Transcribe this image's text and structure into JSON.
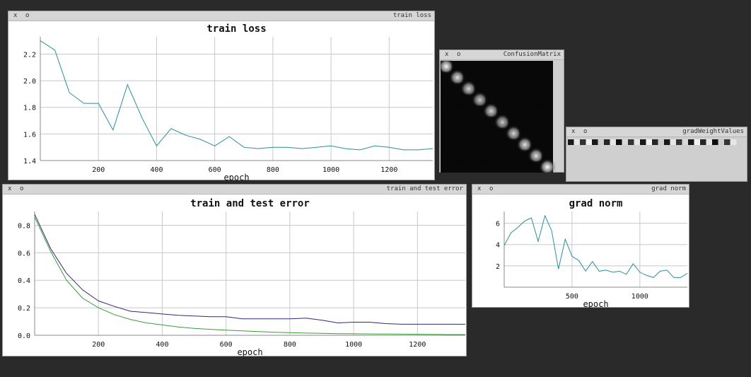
{
  "windows": {
    "train_loss": {
      "btn_x": "x",
      "btn_o": "o",
      "title": "train loss"
    },
    "confusion": {
      "btn_x": "x",
      "btn_o": "o",
      "title": "ConfusionMatrix"
    },
    "gradweight": {
      "btn_x": "x",
      "btn_o": "o",
      "title": "gradWeightValues"
    },
    "error": {
      "btn_x": "x",
      "btn_o": "o",
      "title": "train and test error"
    },
    "gradnorm": {
      "btn_x": "x",
      "btn_o": "o",
      "title": "grad norm"
    }
  },
  "colors": {
    "teal": "#2b8f9a",
    "navy": "#2d2a7a",
    "green": "#3a9a3a"
  },
  "chart_data": [
    {
      "id": "train_loss",
      "type": "line",
      "title": "train loss",
      "xlabel": "epoch",
      "ylabel": "",
      "xlim": [
        0,
        1350
      ],
      "ylim": [
        1.4,
        2.33
      ],
      "xticks": [
        "200",
        "400",
        "600",
        "800",
        "1000",
        "1200"
      ],
      "xtick_values": [
        200,
        400,
        600,
        800,
        1000,
        1200
      ],
      "yticks": [
        "1.4",
        "1.6",
        "1.8",
        "2.0",
        "2.2"
      ],
      "ytick_values": [
        1.4,
        1.6,
        1.8,
        2.0,
        2.2
      ],
      "series": [
        {
          "color": "#2b8f9a",
          "x": [
            0,
            50,
            100,
            150,
            200,
            250,
            300,
            350,
            400,
            450,
            500,
            550,
            600,
            650,
            700,
            750,
            800,
            850,
            900,
            950,
            1000,
            1050,
            1100,
            1150,
            1200,
            1250,
            1300,
            1350
          ],
          "y": [
            2.3,
            2.23,
            1.91,
            1.83,
            1.83,
            1.63,
            1.97,
            1.72,
            1.51,
            1.64,
            1.59,
            1.56,
            1.51,
            1.58,
            1.5,
            1.49,
            1.5,
            1.5,
            1.49,
            1.5,
            1.51,
            1.49,
            1.48,
            1.51,
            1.5,
            1.48,
            1.48,
            1.49
          ]
        }
      ]
    },
    {
      "id": "error",
      "type": "line",
      "title": "train and test error",
      "xlabel": "epoch",
      "ylabel": "",
      "xlim": [
        0,
        1350
      ],
      "ylim": [
        0,
        0.9
      ],
      "xticks": [
        "200",
        "400",
        "600",
        "800",
        "1000",
        "1200"
      ],
      "xtick_values": [
        200,
        400,
        600,
        800,
        1000,
        1200
      ],
      "yticks": [
        "0.0",
        "0.2",
        "0.4",
        "0.6",
        "0.8"
      ],
      "ytick_values": [
        0.0,
        0.2,
        0.4,
        0.6,
        0.8
      ],
      "series": [
        {
          "color": "#2d2a7a",
          "x": [
            0,
            50,
            100,
            150,
            200,
            250,
            300,
            350,
            400,
            450,
            500,
            550,
            600,
            650,
            700,
            750,
            800,
            850,
            900,
            950,
            1000,
            1050,
            1100,
            1150,
            1200,
            1250,
            1300,
            1350
          ],
          "y": [
            0.88,
            0.63,
            0.45,
            0.33,
            0.25,
            0.21,
            0.175,
            0.165,
            0.155,
            0.145,
            0.14,
            0.135,
            0.135,
            0.12,
            0.12,
            0.12,
            0.12,
            0.125,
            0.11,
            0.09,
            0.095,
            0.095,
            0.085,
            0.08,
            0.08,
            0.08,
            0.08,
            0.08
          ]
        },
        {
          "color": "#3a9a3a",
          "x": [
            0,
            50,
            100,
            150,
            200,
            250,
            300,
            350,
            400,
            450,
            500,
            550,
            600,
            650,
            700,
            750,
            800,
            850,
            900,
            950,
            1000,
            1050,
            1100,
            1150,
            1200,
            1250,
            1300,
            1350
          ],
          "y": [
            0.86,
            0.61,
            0.4,
            0.27,
            0.2,
            0.15,
            0.115,
            0.09,
            0.075,
            0.06,
            0.05,
            0.043,
            0.037,
            0.032,
            0.027,
            0.022,
            0.019,
            0.016,
            0.014,
            0.012,
            0.011,
            0.01,
            0.009,
            0.008,
            0.007,
            0.006,
            0.005,
            0.005
          ]
        }
      ]
    },
    {
      "id": "gradnorm",
      "type": "line",
      "title": "grad norm",
      "xlabel": "epoch",
      "ylabel": "",
      "xlim": [
        0,
        1350
      ],
      "ylim": [
        0,
        7.1
      ],
      "xticks": [
        "500",
        "1000"
      ],
      "xtick_values": [
        500,
        1000
      ],
      "yticks": [
        "2",
        "4",
        "6"
      ],
      "ytick_values": [
        2,
        4,
        6
      ],
      "series": [
        {
          "color": "#2b8f9a",
          "x": [
            0,
            50,
            100,
            150,
            200,
            250,
            300,
            350,
            400,
            450,
            500,
            550,
            600,
            650,
            700,
            750,
            800,
            850,
            900,
            950,
            1000,
            1050,
            1100,
            1150,
            1200,
            1250,
            1300,
            1350
          ],
          "y": [
            3.9,
            5.1,
            5.6,
            6.2,
            6.5,
            4.3,
            6.7,
            5.3,
            1.7,
            4.5,
            2.9,
            2.5,
            1.5,
            2.4,
            1.5,
            1.6,
            1.4,
            1.5,
            1.2,
            2.2,
            1.4,
            1.1,
            0.9,
            1.5,
            1.6,
            0.9,
            0.9,
            1.3
          ]
        }
      ]
    },
    {
      "id": "confusion",
      "type": "heatmap",
      "title": "",
      "xlabel": "",
      "ylabel": "",
      "size": 10,
      "diagonal": [
        1.0,
        0.9,
        0.85,
        0.8,
        0.85,
        0.8,
        0.85,
        0.9,
        0.9,
        1.0
      ],
      "off_diagonal": 0.05
    }
  ],
  "gradweight_stripes": [
    0.1,
    0.9,
    0.2,
    0.95,
    0.1,
    0.8,
    0.15,
    0.9,
    0.05,
    0.85,
    0.2,
    0.9,
    0.1,
    0.95,
    0.15,
    0.8,
    0.1,
    0.9,
    0.2,
    0.85,
    0.1,
    0.95,
    0.15,
    0.9,
    0.05,
    0.8,
    0.2,
    0.9
  ]
}
